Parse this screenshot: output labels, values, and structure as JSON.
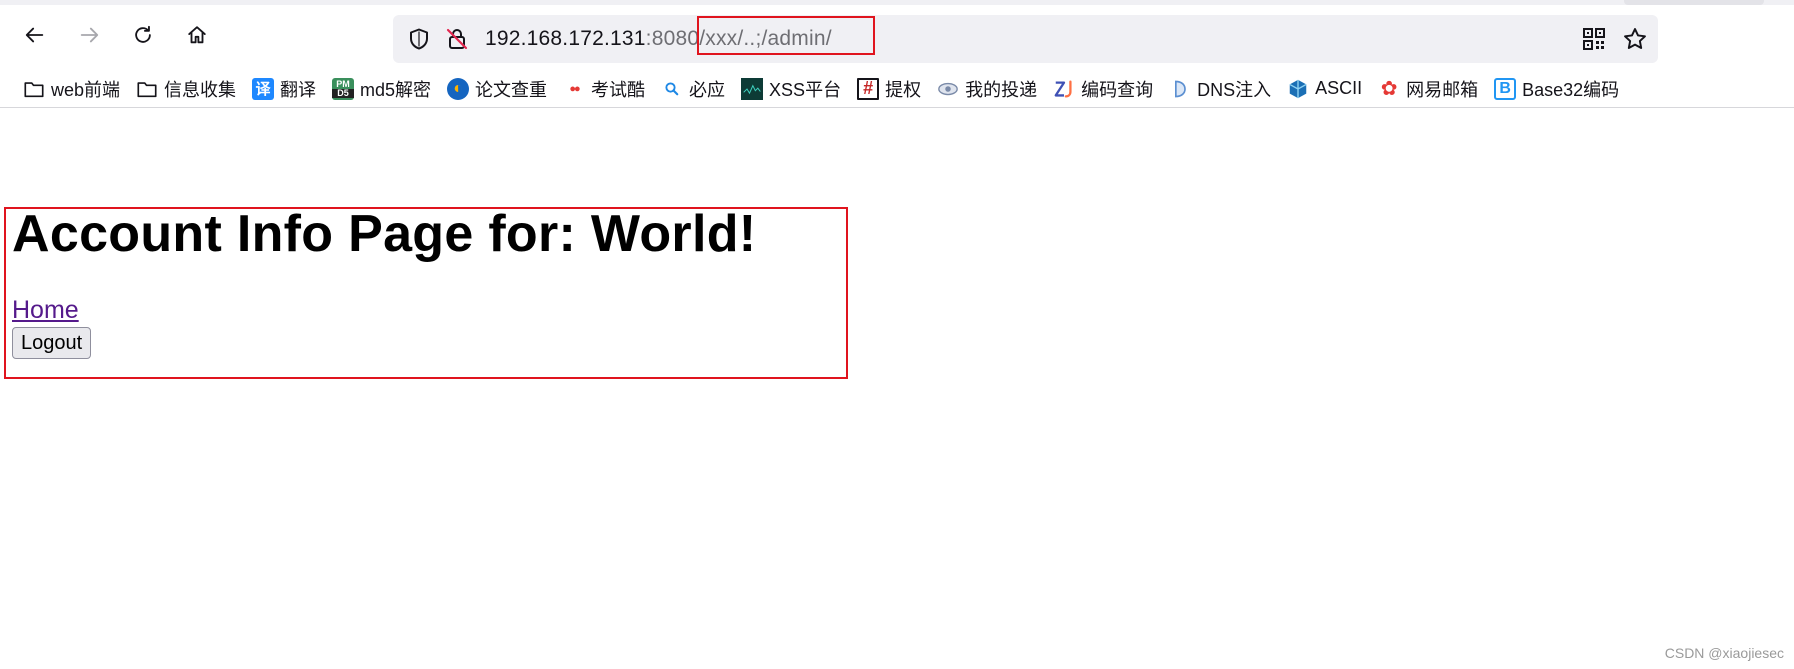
{
  "browser": {
    "url": {
      "host": "192.168.172.131",
      "port": ":8080",
      "path": "/xxx/..;/admin/"
    },
    "bookmarks": [
      {
        "label": "web前端",
        "icon": "folder-icon"
      },
      {
        "label": "信息收集",
        "icon": "folder-icon"
      },
      {
        "label": "翻译",
        "icon": "translate-icon",
        "glyph": "译",
        "color": "#1e88ff"
      },
      {
        "label": "md5解密",
        "icon": "md5-icon",
        "glyph": "PM",
        "color": "#3a8f5c"
      },
      {
        "label": "论文查重",
        "icon": "paper-check-icon",
        "glyph": "◐",
        "color": "#1565c0"
      },
      {
        "label": "考试酷",
        "icon": "exam-icon",
        "glyph": "●●",
        "color": "#e53935"
      },
      {
        "label": "必应",
        "icon": "bing-search-icon",
        "glyph": "🔍",
        "color": "#1e88e5"
      },
      {
        "label": "XSS平台",
        "icon": "xss-icon",
        "glyph": "",
        "color": "#0d3b36"
      },
      {
        "label": "提权",
        "icon": "hash-grid-icon",
        "glyph": "#",
        "color": "#c62828"
      },
      {
        "label": "我的投递",
        "icon": "eye-icon",
        "glyph": "◉",
        "color": "#7a8aa8"
      },
      {
        "label": "编码查询",
        "icon": "zj-icon",
        "glyph": "ZJ",
        "color": "#3f51b5"
      },
      {
        "label": "DNS注入",
        "icon": "dns-icon",
        "glyph": "D",
        "color": "#5b8fd1"
      },
      {
        "label": "ASCII",
        "icon": "ascii-icon",
        "glyph": "◆",
        "color": "#1b6fb5"
      },
      {
        "label": "网易邮箱",
        "icon": "netease-mail-icon",
        "glyph": "✿",
        "color": "#e53935"
      },
      {
        "label": "Base32编码",
        "icon": "base32-icon",
        "glyph": "B",
        "color": "#2196f3"
      }
    ]
  },
  "page": {
    "title": "Account Info Page for: World!",
    "home_link": "Home",
    "logout_button": "Logout"
  },
  "watermark": "CSDN @xiaojiesec",
  "colors": {
    "highlight": "#e0141e",
    "visited_link": "#551a8b"
  }
}
